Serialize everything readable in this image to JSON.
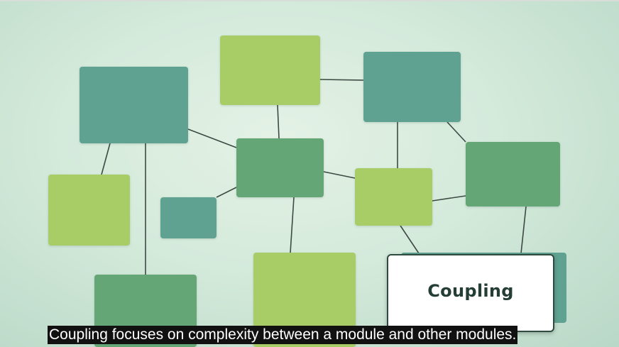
{
  "scene": {
    "card": {
      "title": "Coupling"
    },
    "caption": {
      "text": "Coupling focuses on complexity between a module and other modules."
    },
    "colors": {
      "teal": "#5fa291",
      "green": "#64a676",
      "lime": "#a8cd67",
      "link": "#3d4a44",
      "background": "#d4eadb"
    }
  }
}
